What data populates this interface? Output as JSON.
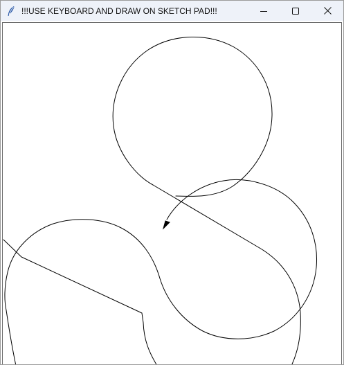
{
  "window": {
    "title": "!!!USE KEYBOARD AND DRAW ON SKETCH PAD!!!",
    "app_icon": "feather-icon",
    "controls": [
      "minimize-icon",
      "maximize-icon",
      "close-icon"
    ]
  },
  "canvas": {
    "background": "#ffffff",
    "stroke_color": "#000000",
    "turtle_cursor_icon": "arrow-cursor-icon"
  }
}
